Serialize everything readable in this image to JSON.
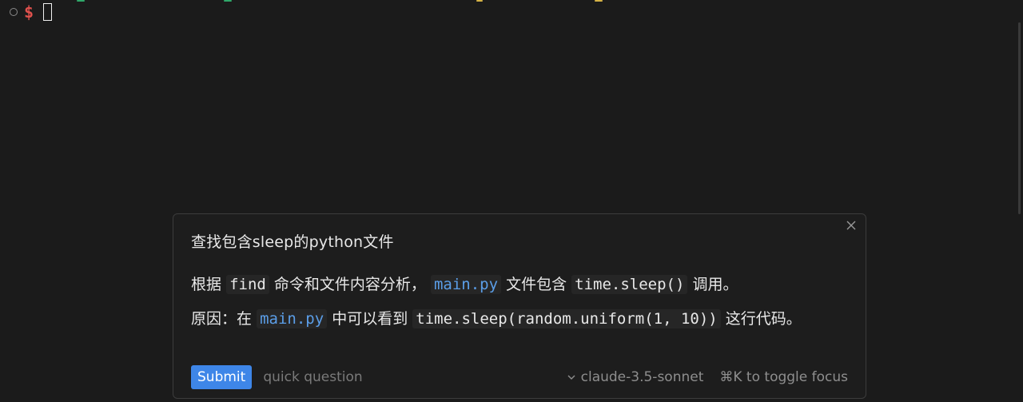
{
  "terminal": {
    "prompt_symbol": "$"
  },
  "ai_panel": {
    "query": "查找包含sleep的python文件",
    "answer": {
      "line1": {
        "p1": "根据",
        "code_find": "find",
        "p2": "命令和文件内容分析，",
        "file1": "main.py",
        "p3": "文件包含",
        "code_sleep": "time.sleep()",
        "p4": "调用。"
      },
      "line2": {
        "p1": "原因：在",
        "file1": "main.py",
        "p2": "中可以看到",
        "code_call": "time.sleep(random.uniform(1, 10))",
        "p3": "这行代码。"
      }
    },
    "footer": {
      "submit_label": "Submit",
      "input_placeholder": "quick question",
      "model": "claude-3.5-sonnet",
      "toggle_hint": "⌘K to toggle focus"
    }
  }
}
